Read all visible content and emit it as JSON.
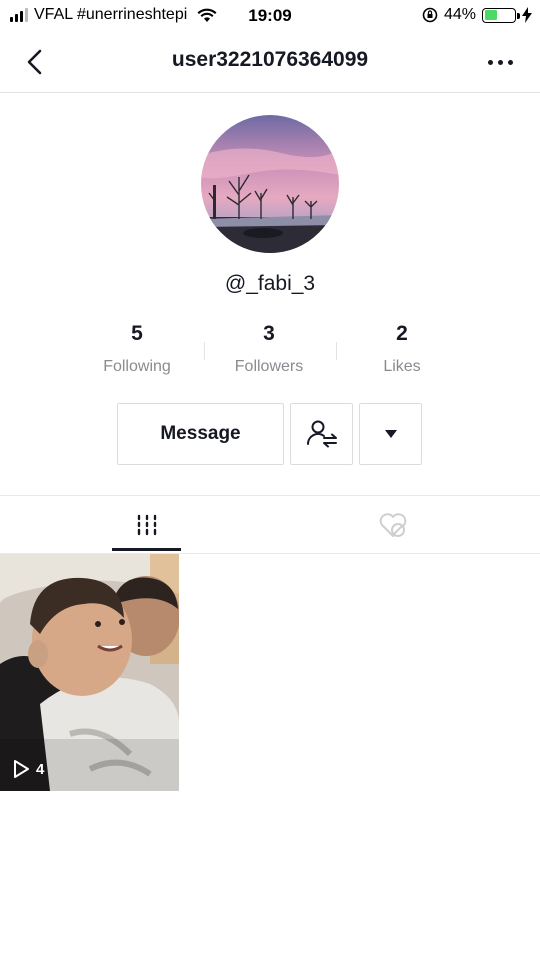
{
  "status_bar": {
    "carrier": "VFAL #unerrineshtepi",
    "time": "19:09",
    "battery_percent": "44%",
    "battery_level": 0.44
  },
  "header": {
    "username": "user3221076364099",
    "icons": [
      "back-arrow-icon",
      "more-dots-icon"
    ]
  },
  "profile": {
    "handle": "@_fabi_3",
    "stats": [
      {
        "value": "5",
        "label": "Following"
      },
      {
        "value": "3",
        "label": "Followers"
      },
      {
        "value": "2",
        "label": "Likes"
      }
    ]
  },
  "actions": {
    "message_label": "Message",
    "icons": [
      "follow-status-icon",
      "dropdown-arrow-icon"
    ]
  },
  "tabs": [
    {
      "name": "videos",
      "icon": "grid-icon",
      "active": true
    },
    {
      "name": "liked",
      "icon": "hidden-likes-icon",
      "active": false
    }
  ],
  "videos": [
    {
      "views": "4"
    }
  ],
  "colors": {
    "text": "#161823",
    "secondary_text": "#8a8b91",
    "border": "#dcdcde",
    "battery": "#4cd964"
  }
}
